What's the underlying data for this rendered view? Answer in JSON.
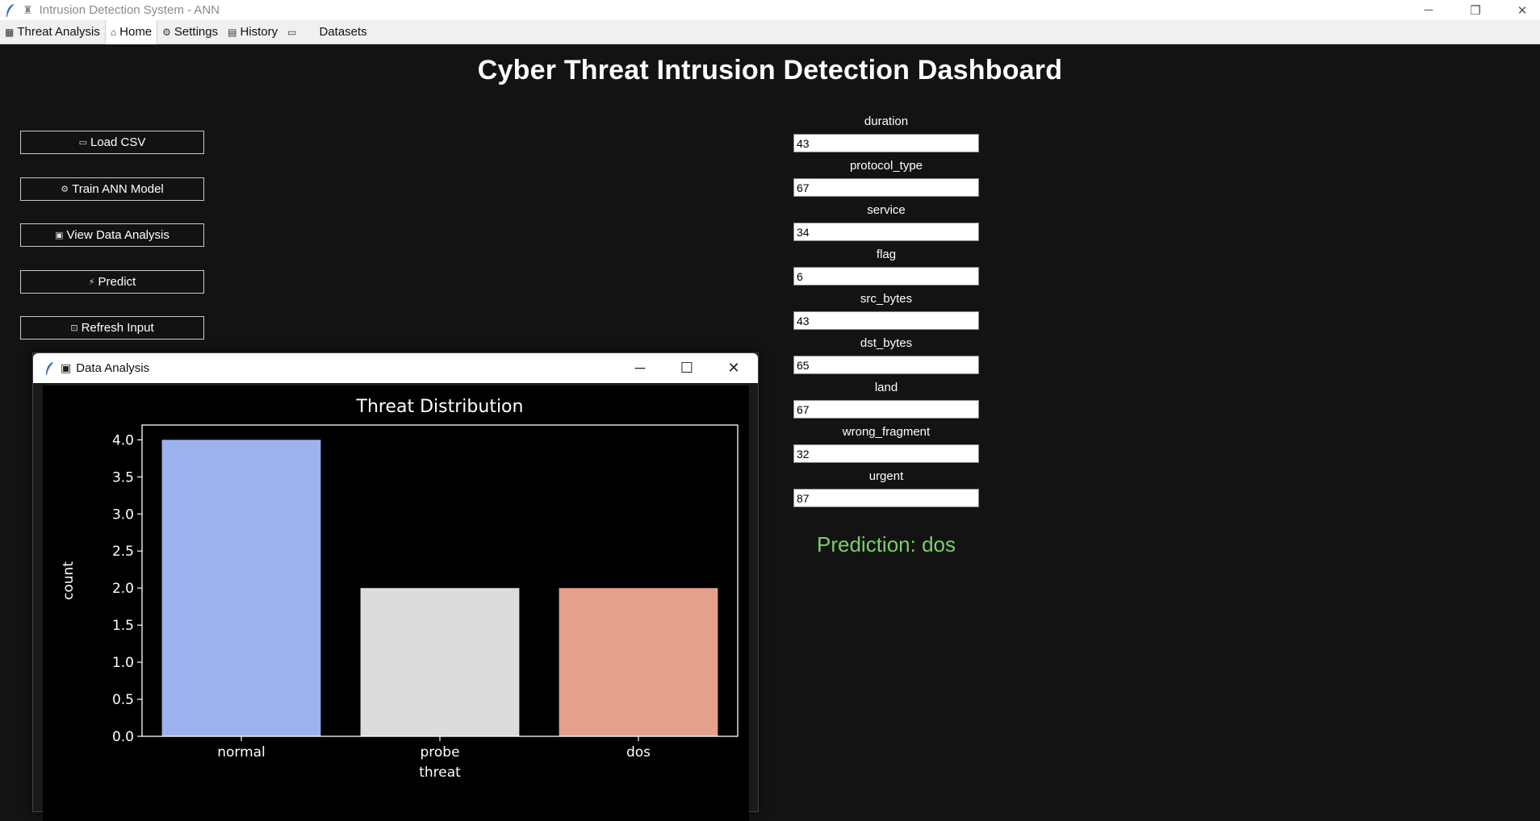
{
  "window": {
    "title": "Intrusion Detection System - ANN",
    "controls": {
      "minimize": "─",
      "restore": "❐",
      "close": "✕"
    }
  },
  "tabs": [
    {
      "icon": "▦",
      "label": "Threat Analysis"
    },
    {
      "icon": "⌂",
      "label": "Home",
      "active": true
    },
    {
      "icon": "⚙",
      "label": "Settings"
    },
    {
      "icon": "▤",
      "label": "History"
    },
    {
      "icon": "▭",
      "label": ""
    },
    {
      "icon": "",
      "label": "Datasets"
    }
  ],
  "dashboard": {
    "title": "Cyber Threat Intrusion Detection Dashboard",
    "buttons": [
      {
        "icon": "▭",
        "label": "Load CSV"
      },
      {
        "icon": "⚙",
        "label": "Train ANN Model"
      },
      {
        "icon": "▣",
        "label": "View Data Analysis"
      },
      {
        "icon": "⚡",
        "label": "Predict"
      },
      {
        "icon": "⊡",
        "label": "Refresh Input"
      }
    ],
    "fields": [
      {
        "label": "duration",
        "value": "43"
      },
      {
        "label": "protocol_type",
        "value": "67"
      },
      {
        "label": "service",
        "value": "34"
      },
      {
        "label": "flag",
        "value": "6"
      },
      {
        "label": "src_bytes",
        "value": "43"
      },
      {
        "label": "dst_bytes",
        "value": "65"
      },
      {
        "label": "land",
        "value": "67"
      },
      {
        "label": "wrong_fragment",
        "value": "32"
      },
      {
        "label": "urgent",
        "value": "87"
      }
    ],
    "prediction": "Prediction: dos"
  },
  "popup": {
    "title": "Data Analysis",
    "icon": "▣",
    "controls": {
      "minimize": "─",
      "maximize": "☐",
      "close": "✕"
    }
  },
  "chart_data": {
    "type": "bar",
    "title": "Threat Distribution",
    "xlabel": "threat",
    "ylabel": "count",
    "categories": [
      "normal",
      "probe",
      "dos"
    ],
    "values": [
      4,
      2,
      2
    ],
    "colors": [
      "#9db3ef",
      "#dcdcdc",
      "#e4a08a"
    ],
    "ylim": [
      0,
      4.2
    ],
    "yticks": [
      "0.0",
      "0.5",
      "1.0",
      "1.5",
      "2.0",
      "2.5",
      "3.0",
      "3.5",
      "4.0"
    ],
    "grid": false,
    "background": "#000000",
    "text_color": "#ffffff"
  }
}
